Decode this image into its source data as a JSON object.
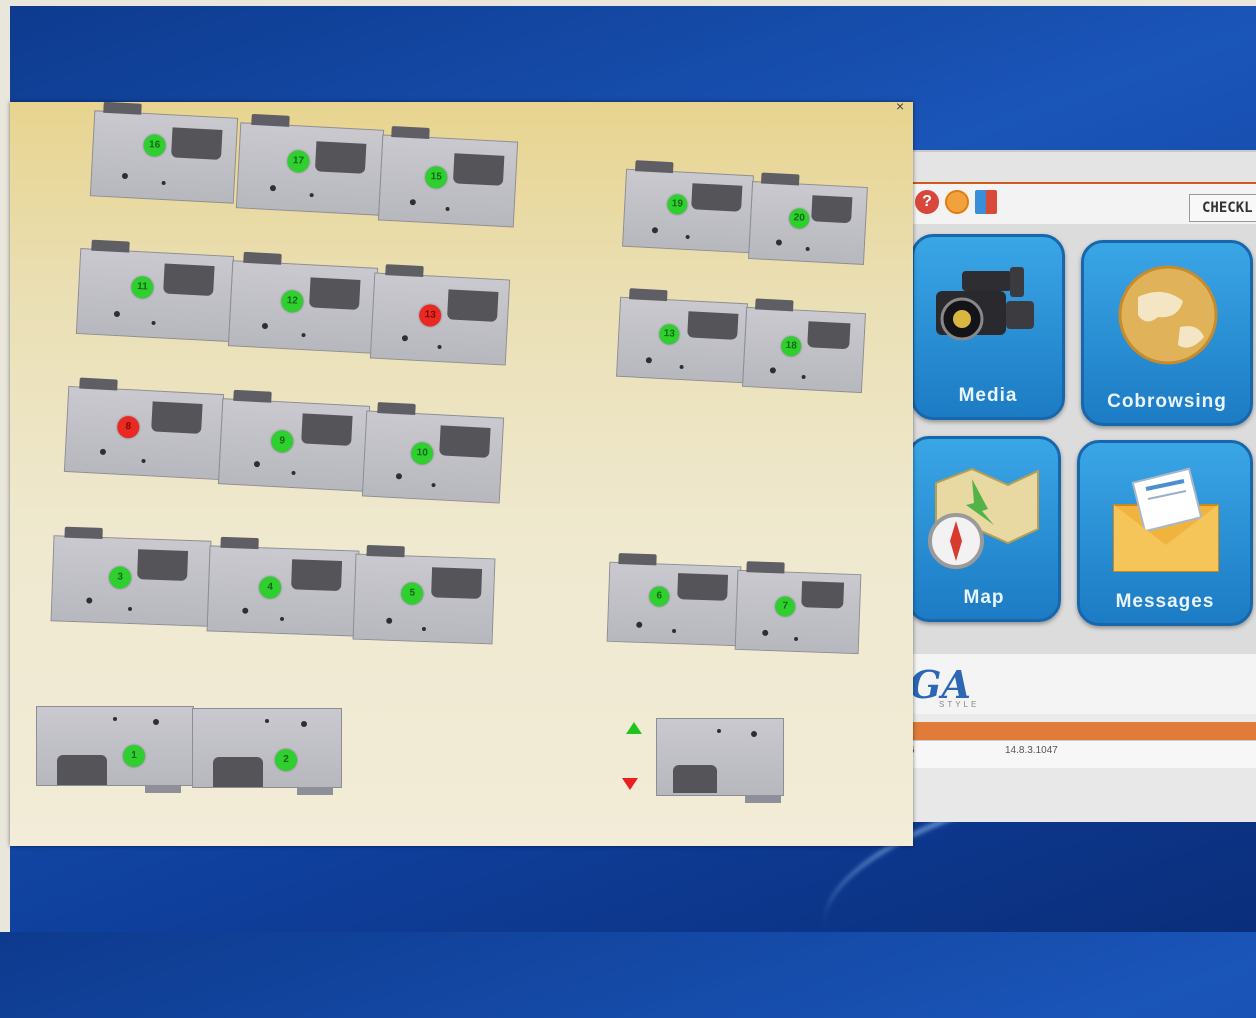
{
  "app": {
    "check_label": "CHECKL",
    "help_icon": "?",
    "tiles": [
      {
        "label": "Media",
        "icon": "video-camera-icon"
      },
      {
        "label": "Cobrowsing",
        "icon": "globe-icon"
      },
      {
        "label": "Map",
        "icon": "map-compass-icon"
      },
      {
        "label": "Messages",
        "icon": "envelope-icon"
      }
    ],
    "logo": "GA",
    "logo_sub": "STYLE",
    "status_left": "6",
    "status_ip": "14.8.3.1047"
  },
  "cylinders": [
    {
      "id": "16",
      "status": "ok"
    },
    {
      "id": "17",
      "status": "ok"
    },
    {
      "id": "15",
      "status": "ok"
    },
    {
      "id": "19",
      "status": "ok"
    },
    {
      "id": "20",
      "status": "ok"
    },
    {
      "id": "11",
      "status": "ok"
    },
    {
      "id": "12",
      "status": "ok"
    },
    {
      "id": "13",
      "status": "alert"
    },
    {
      "id": "13",
      "status": "ok"
    },
    {
      "id": "18",
      "status": "ok"
    },
    {
      "id": "8",
      "status": "alert"
    },
    {
      "id": "9",
      "status": "ok"
    },
    {
      "id": "10",
      "status": "ok"
    },
    {
      "id": "3",
      "status": "ok"
    },
    {
      "id": "4",
      "status": "ok"
    },
    {
      "id": "5",
      "status": "ok"
    },
    {
      "id": "6",
      "status": "ok"
    },
    {
      "id": "7",
      "status": "ok"
    },
    {
      "id": "1",
      "status": "ok"
    },
    {
      "id": "2",
      "status": "ok"
    }
  ],
  "colors": {
    "ok": "#2fcf2f",
    "alert": "#ea2a22",
    "accent": "#e07b3a"
  }
}
